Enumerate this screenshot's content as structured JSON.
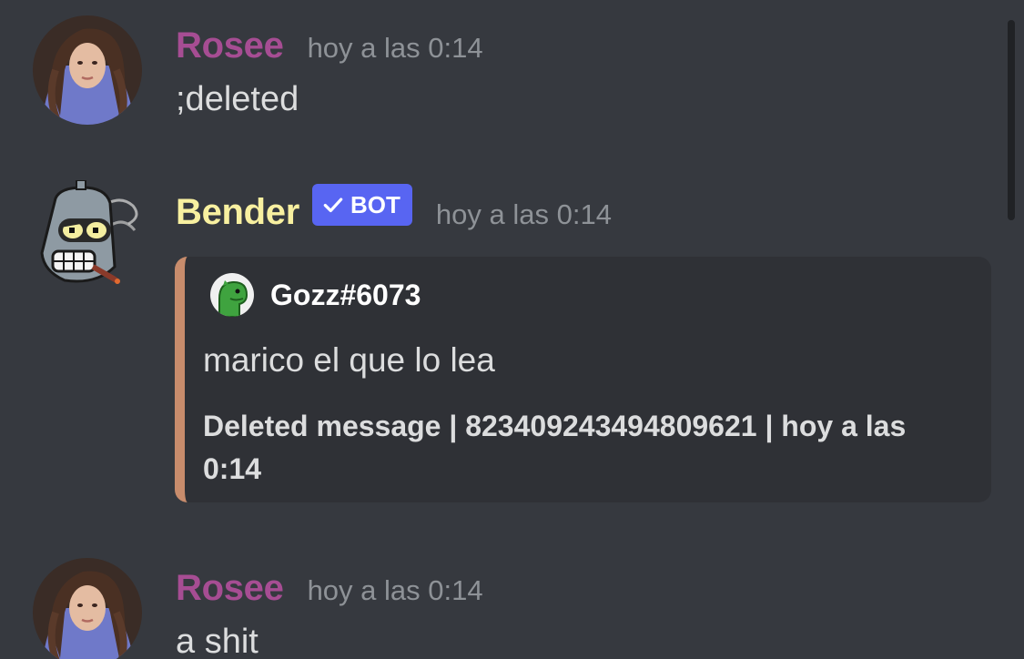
{
  "messages": [
    {
      "username": "Rosee",
      "username_color": "#a64d93",
      "timestamp": "hoy a las 0:14",
      "content": ";deleted",
      "avatar": "girl-portrait-avatar"
    },
    {
      "username": "Bender",
      "username_color": "#f8f0a0",
      "bot_tag": "BOT",
      "timestamp": "hoy a las 0:14",
      "avatar": "bender-robot-avatar",
      "embed": {
        "color": "#c88c6c",
        "author_name": "Gozz#6073",
        "author_icon": "green-dinosaur-icon",
        "description": "marico el que lo lea",
        "footer_line1": "Deleted message | 823409243494809621 | hoy a las",
        "footer_line2": "0:14"
      }
    },
    {
      "username": "Rosee",
      "username_color": "#a64d93",
      "timestamp": "hoy a las 0:14",
      "content": "a shit",
      "avatar": "girl-portrait-avatar"
    }
  ],
  "colors": {
    "background": "#36393f",
    "embed_background": "#2f3136",
    "bot_tag": "#5865f2",
    "timestamp": "#8e9297",
    "text": "#dcddde"
  }
}
